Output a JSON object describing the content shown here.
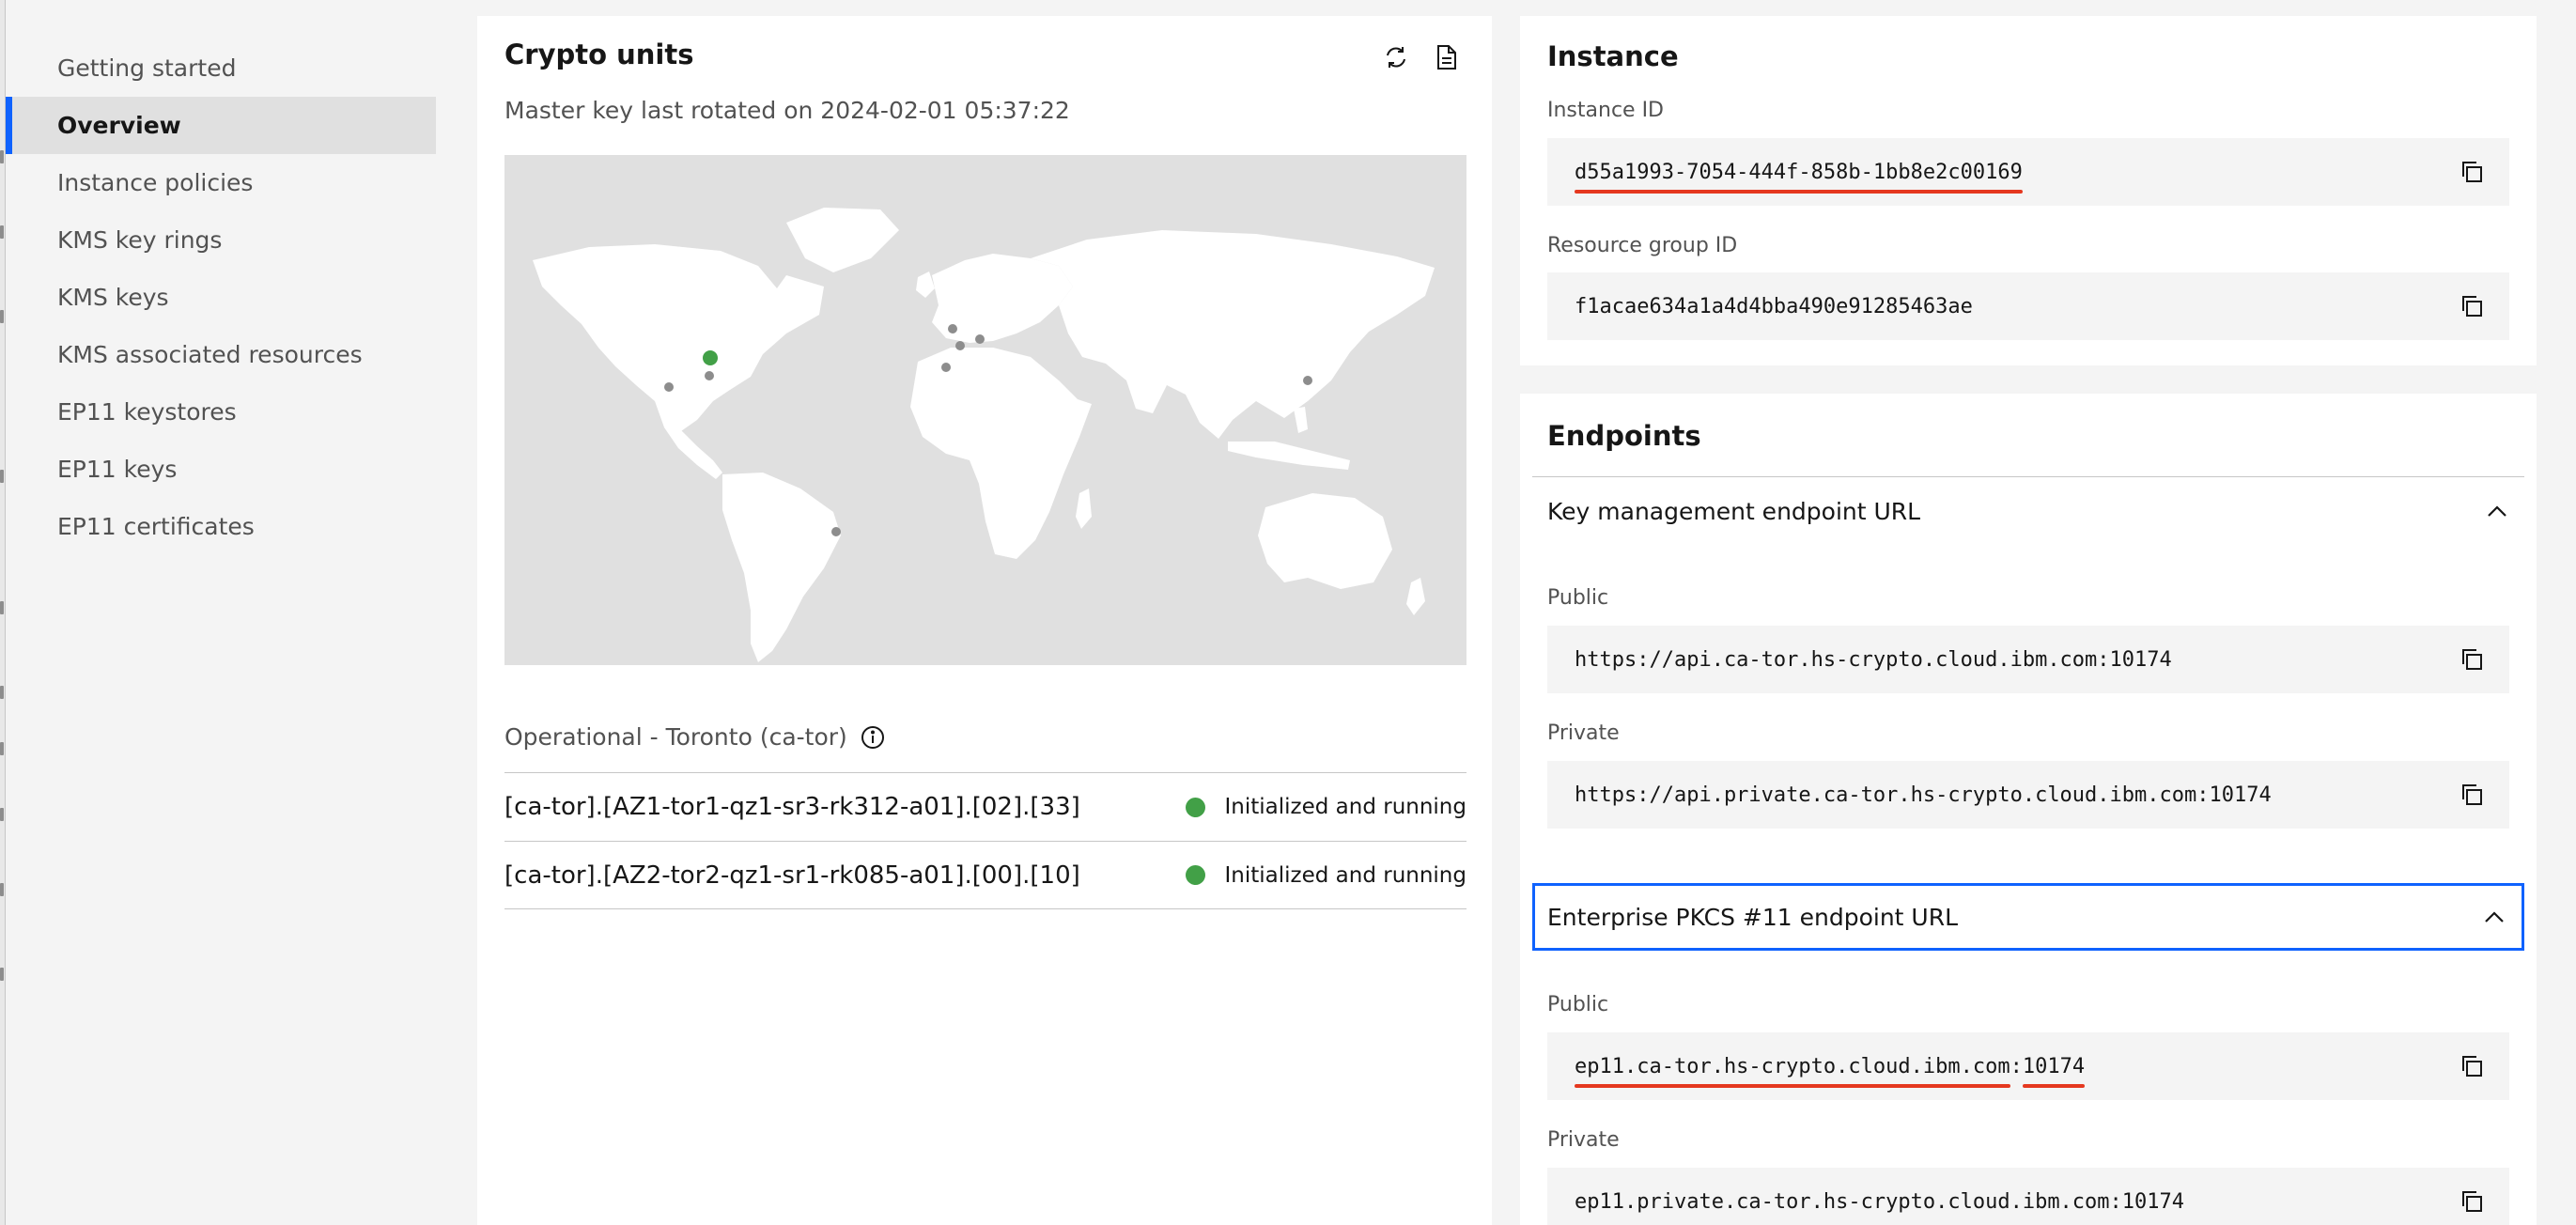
{
  "sidebar": {
    "items": [
      {
        "label": "Getting started",
        "active": false
      },
      {
        "label": "Overview",
        "active": true
      },
      {
        "label": "Instance policies",
        "active": false
      },
      {
        "label": "KMS key rings",
        "active": false
      },
      {
        "label": "KMS keys",
        "active": false
      },
      {
        "label": "KMS associated resources",
        "active": false
      },
      {
        "label": "EP11 keystores",
        "active": false
      },
      {
        "label": "EP11 keys",
        "active": false
      },
      {
        "label": "EP11 certificates",
        "active": false
      }
    ]
  },
  "crypto": {
    "title": "Crypto units",
    "master_key_text": "Master key last rotated on 2024-02-01 05:37:22",
    "refresh_icon": "refresh-icon",
    "document_icon": "document-icon",
    "map": {
      "highlight_color": "#42a047",
      "marker_color": "#8d8d8d"
    },
    "status_header": "Operational - Toronto (ca-tor)",
    "units": [
      {
        "name": "[ca-tor].[AZ1-tor1-qz1-sr3-rk312-a01].[02].[33]",
        "status": "Initialized and running"
      },
      {
        "name": "[ca-tor].[AZ2-tor2-qz1-sr1-rk085-a01].[00].[10]",
        "status": "Initialized and running"
      }
    ]
  },
  "instance": {
    "title": "Instance",
    "instance_id_label": "Instance ID",
    "instance_id": "d55a1993-7054-444f-858b-1bb8e2c00169",
    "resource_group_label": "Resource group ID",
    "resource_group_id": "f1acae634a1a4d4bba490e91285463ae"
  },
  "endpoints": {
    "title": "Endpoints",
    "kms": {
      "label": "Key management endpoint URL",
      "public_label": "Public",
      "public_url": "https://api.ca-tor.hs-crypto.cloud.ibm.com:10174",
      "private_label": "Private",
      "private_url": "https://api.private.ca-tor.hs-crypto.cloud.ibm.com:10174"
    },
    "ep11": {
      "label": "Enterprise PKCS #11 endpoint URL",
      "public_label": "Public",
      "public_host": "ep11.ca-tor.hs-crypto.cloud.ibm.com",
      "public_sep": ":",
      "public_port": "10174",
      "private_label": "Private",
      "private_url": "ep11.private.ca-tor.hs-crypto.cloud.ibm.com:10174"
    }
  },
  "colors": {
    "accent": "#0f62fe",
    "annotation": "#e5381f",
    "status_ok": "#42a047"
  }
}
